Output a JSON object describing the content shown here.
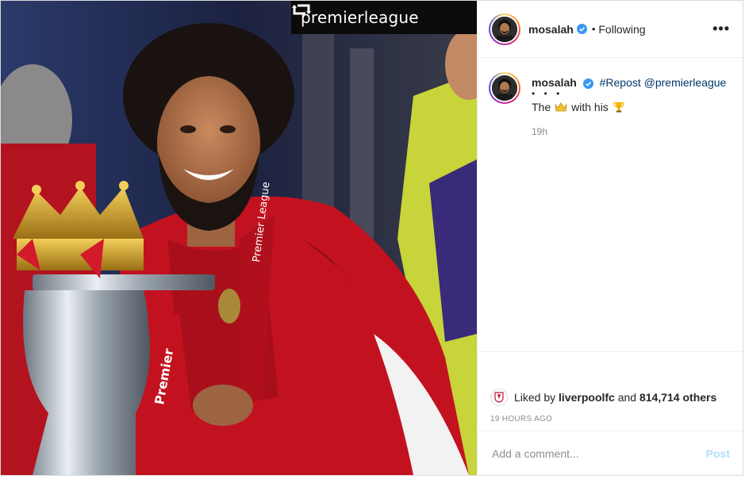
{
  "photo": {
    "repost_tag": "premierleague",
    "repost_icon": "repost-icon"
  },
  "header": {
    "username": "mosalah",
    "separator": "•",
    "follow_status": "Following",
    "more": "•••"
  },
  "caption": {
    "username": "mosalah",
    "tag_text": "#Repost @premierleague",
    "dots": "• • •",
    "text_before": "The",
    "crown_emoji": "crown-emoji",
    "text_mid": "with his",
    "trophy_emoji": "trophy-emoji",
    "time": "19h"
  },
  "likes": {
    "prefix": "Liked by",
    "liker": "liverpoolfc",
    "and": "and",
    "count": "814,714 others"
  },
  "timestamp": "19 HOURS AGO",
  "comment_box": {
    "placeholder": "Add a comment...",
    "post_label": "Post"
  },
  "colors": {
    "link": "#00376b",
    "verified": "#3897f0",
    "post_disabled": "#b2dffc",
    "muted": "#8e8e8e"
  }
}
